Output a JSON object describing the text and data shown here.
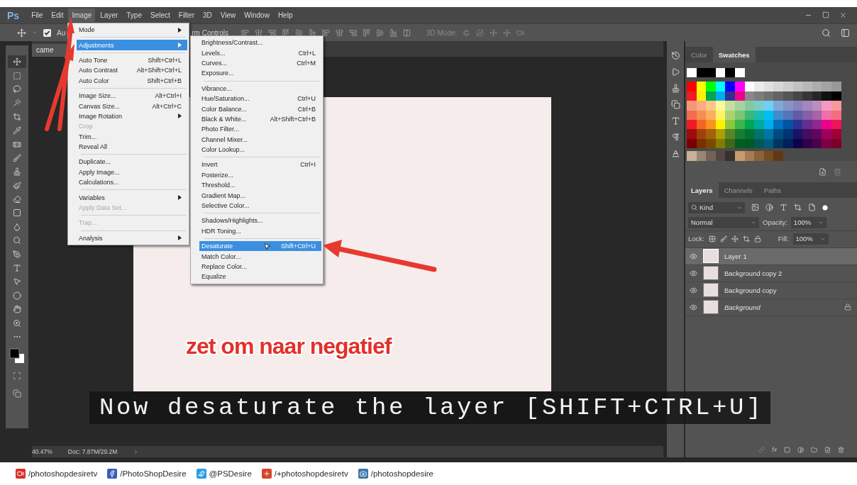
{
  "menu_bar": {
    "logo": "Ps",
    "items": [
      {
        "label": "File",
        "selected": false
      },
      {
        "label": "Edit",
        "selected": false
      },
      {
        "label": "Image",
        "selected": true
      },
      {
        "label": "Layer",
        "selected": false
      },
      {
        "label": "Type",
        "selected": false
      },
      {
        "label": "Select",
        "selected": false
      },
      {
        "label": "Filter",
        "selected": false
      },
      {
        "label": "3D",
        "selected": false
      },
      {
        "label": "View",
        "selected": false
      },
      {
        "label": "Window",
        "selected": false
      },
      {
        "label": "Help",
        "selected": false
      }
    ]
  },
  "options_bar": {
    "auto_select": {
      "label": "Au",
      "checked": true
    },
    "transform_label": "rm Controls",
    "mode_label": "3D Mode:"
  },
  "document_tab": {
    "label": "came"
  },
  "toolbar": {
    "tools": [
      {
        "kind": "move",
        "selected": true
      },
      {
        "kind": "marquee",
        "selected": false
      },
      {
        "kind": "lasso",
        "selected": false
      },
      {
        "kind": "wand",
        "selected": false
      },
      {
        "kind": "crop",
        "selected": false
      },
      {
        "kind": "eyedropper",
        "selected": false
      },
      {
        "kind": "bandage",
        "selected": false
      },
      {
        "kind": "brush",
        "selected": false
      },
      {
        "kind": "stamp",
        "selected": false
      },
      {
        "kind": "history",
        "selected": false
      },
      {
        "kind": "eraser",
        "selected": false
      },
      {
        "kind": "gradient",
        "selected": false
      },
      {
        "kind": "blur",
        "selected": false
      },
      {
        "kind": "dodge",
        "selected": false
      },
      {
        "kind": "pen",
        "selected": false
      },
      {
        "kind": "type",
        "selected": false
      },
      {
        "kind": "pointer",
        "selected": false
      },
      {
        "kind": "ellipse",
        "selected": false
      },
      {
        "kind": "hand",
        "selected": false
      },
      {
        "kind": "zoom",
        "selected": false
      },
      {
        "kind": "more",
        "selected": false
      }
    ]
  },
  "image_menu": {
    "groups": [
      {
        "items": [
          {
            "label": "Mode",
            "has_submenu": true,
            "disabled": false,
            "selected": false
          }
        ]
      },
      {
        "items": [
          {
            "label": "Adjustments",
            "has_submenu": true,
            "disabled": false,
            "selected": true
          }
        ]
      },
      {
        "items": [
          {
            "label": "Auto Tone",
            "shortcut": "Shift+Ctrl+L",
            "has_submenu": false,
            "disabled": false,
            "selected": false
          },
          {
            "label": "Auto Contrast",
            "shortcut": "Alt+Shift+Ctrl+L",
            "has_submenu": false,
            "disabled": false,
            "selected": false
          },
          {
            "label": "Auto Color",
            "shortcut": "Shift+Ctrl+B",
            "has_submenu": false,
            "disabled": false,
            "selected": false
          }
        ]
      },
      {
        "items": [
          {
            "label": "Image Size...",
            "shortcut": "Alt+Ctrl+I",
            "has_submenu": false,
            "disabled": false,
            "selected": false
          },
          {
            "label": "Canvas Size...",
            "shortcut": "Alt+Ctrl+C",
            "has_submenu": false,
            "disabled": false,
            "selected": false
          },
          {
            "label": "Image Rotation",
            "has_submenu": true,
            "disabled": false,
            "selected": false
          },
          {
            "label": "Crop",
            "has_submenu": false,
            "disabled": true,
            "selected": false
          },
          {
            "label": "Trim...",
            "has_submenu": false,
            "disabled": false,
            "selected": false
          },
          {
            "label": "Reveal All",
            "has_submenu": false,
            "disabled": false,
            "selected": false
          }
        ]
      },
      {
        "items": [
          {
            "label": "Duplicate...",
            "has_submenu": false,
            "disabled": false,
            "selected": false
          },
          {
            "label": "Apply Image...",
            "has_submenu": false,
            "disabled": false,
            "selected": false
          },
          {
            "label": "Calculations...",
            "has_submenu": false,
            "disabled": false,
            "selected": false
          }
        ]
      },
      {
        "items": [
          {
            "label": "Variables",
            "has_submenu": true,
            "disabled": false,
            "selected": false
          },
          {
            "label": "Apply Data Set...",
            "has_submenu": false,
            "disabled": true,
            "selected": false
          }
        ]
      },
      {
        "items": [
          {
            "label": "Trap...",
            "has_submenu": false,
            "disabled": true,
            "selected": false
          }
        ]
      },
      {
        "items": [
          {
            "label": "Analysis",
            "has_submenu": true,
            "disabled": false,
            "selected": false
          }
        ]
      }
    ]
  },
  "adjustments_menu": {
    "groups": [
      {
        "items": [
          {
            "label": "Brightness/Contrast...",
            "selected": false
          },
          {
            "label": "Levels...",
            "shortcut": "Ctrl+L",
            "selected": false
          },
          {
            "label": "Curves...",
            "shortcut": "Ctrl+M",
            "selected": false
          },
          {
            "label": "Exposure...",
            "selected": false
          }
        ]
      },
      {
        "items": [
          {
            "label": "Vibrance...",
            "selected": false
          },
          {
            "label": "Hue/Saturation...",
            "shortcut": "Ctrl+U",
            "selected": false
          },
          {
            "label": "Color Balance...",
            "shortcut": "Ctrl+B",
            "selected": false
          },
          {
            "label": "Black & White...",
            "shortcut": "Alt+Shift+Ctrl+B",
            "selected": false
          },
          {
            "label": "Photo Filter...",
            "selected": false
          },
          {
            "label": "Channel Mixer...",
            "selected": false
          },
          {
            "label": "Color Lookup...",
            "selected": false
          }
        ]
      },
      {
        "items": [
          {
            "label": "Invert",
            "shortcut": "Ctrl+I",
            "selected": false
          },
          {
            "label": "Posterize...",
            "selected": false
          },
          {
            "label": "Threshold...",
            "selected": false
          },
          {
            "label": "Gradient Map...",
            "selected": false
          },
          {
            "label": "Selective Color...",
            "selected": false
          }
        ]
      },
      {
        "items": [
          {
            "label": "Shadows/Highlights...",
            "selected": false
          },
          {
            "label": "HDR Toning...",
            "selected": false
          }
        ]
      },
      {
        "items": [
          {
            "label": "Desaturate",
            "shortcut": "Shift+Ctrl+U",
            "selected": true
          },
          {
            "label": "Match Color...",
            "selected": false
          },
          {
            "label": "Replace Color...",
            "selected": false
          },
          {
            "label": "Equalize",
            "selected": false
          }
        ]
      }
    ]
  },
  "caption": {
    "overlay_text": "zet om naar negatief",
    "subtitle": "Now desaturate the layer [SHIFT+CTRL+U]"
  },
  "status_bar": {
    "zoom": "40.47%",
    "doc_size": "Doc: 7.87M/29.2M"
  },
  "swatches_panel": {
    "tabs": [
      {
        "label": "Color",
        "selected": false
      },
      {
        "label": "Swatches",
        "selected": true
      }
    ],
    "rows": [
      {
        "swatches": [
          {
            "color": "#ffffff"
          },
          {
            "color": "#000000"
          },
          {
            "color": "#000000"
          },
          {
            "color": "#ffffff"
          },
          {
            "color": "#000000"
          },
          {
            "color": "#ffffff"
          }
        ]
      },
      {
        "swatches": [
          {
            "color": "#ff0000"
          },
          {
            "color": "#ffff00"
          },
          {
            "color": "#00ff00"
          },
          {
            "color": "#00ffff"
          },
          {
            "color": "#0000ff"
          },
          {
            "color": "#ff00ff"
          },
          {
            "color": "#ffffff"
          },
          {
            "color": "#ebebeb"
          },
          {
            "color": "#e0e0e0"
          },
          {
            "color": "#d6d6d6"
          },
          {
            "color": "#cccccc"
          },
          {
            "color": "#c2c2c2"
          },
          {
            "color": "#b8b8b8"
          },
          {
            "color": "#adadad"
          },
          {
            "color": "#a3a3a3"
          },
          {
            "color": "#999999"
          }
        ]
      },
      {
        "swatches": [
          {
            "color": "#ed1c24"
          },
          {
            "color": "#fff200"
          },
          {
            "color": "#00a651"
          },
          {
            "color": "#00aeef"
          },
          {
            "color": "#2e3192"
          },
          {
            "color": "#ec008c"
          },
          {
            "color": "#898989"
          },
          {
            "color": "#7d7d7d"
          },
          {
            "color": "#707070"
          },
          {
            "color": "#636363"
          },
          {
            "color": "#555555"
          },
          {
            "color": "#464646"
          },
          {
            "color": "#363636"
          },
          {
            "color": "#262626"
          },
          {
            "color": "#111111"
          },
          {
            "color": "#000000"
          }
        ]
      },
      {
        "swatches": [
          {
            "color": "#f7977a"
          },
          {
            "color": "#f9ad81"
          },
          {
            "color": "#fdc68a"
          },
          {
            "color": "#fff79a"
          },
          {
            "color": "#c4df9b"
          },
          {
            "color": "#a3d39c"
          },
          {
            "color": "#82ca9d"
          },
          {
            "color": "#7bcdc8"
          },
          {
            "color": "#6ecff6"
          },
          {
            "color": "#7ea7d8"
          },
          {
            "color": "#8493ca"
          },
          {
            "color": "#8882be"
          },
          {
            "color": "#a187be"
          },
          {
            "color": "#bc8dbf"
          },
          {
            "color": "#f49ac2"
          },
          {
            "color": "#f6989d"
          }
        ]
      },
      {
        "swatches": [
          {
            "color": "#f26c4f"
          },
          {
            "color": "#f68e55"
          },
          {
            "color": "#fbaf5c"
          },
          {
            "color": "#fff467"
          },
          {
            "color": "#acd372"
          },
          {
            "color": "#7cc576"
          },
          {
            "color": "#3bb878"
          },
          {
            "color": "#1abbb4"
          },
          {
            "color": "#00bff3"
          },
          {
            "color": "#438ccb"
          },
          {
            "color": "#5574b9"
          },
          {
            "color": "#605ca8"
          },
          {
            "color": "#855fa8"
          },
          {
            "color": "#a763a8"
          },
          {
            "color": "#f06ea9"
          },
          {
            "color": "#f26d7d"
          }
        ]
      },
      {
        "swatches": [
          {
            "color": "#ed1c24"
          },
          {
            "color": "#f26522"
          },
          {
            "color": "#f7941d"
          },
          {
            "color": "#fff200"
          },
          {
            "color": "#8dc73f"
          },
          {
            "color": "#39b54a"
          },
          {
            "color": "#00a651"
          },
          {
            "color": "#00a99d"
          },
          {
            "color": "#00aeef"
          },
          {
            "color": "#0072bc"
          },
          {
            "color": "#0054a6"
          },
          {
            "color": "#2e3192"
          },
          {
            "color": "#662d91"
          },
          {
            "color": "#92278f"
          },
          {
            "color": "#ec008c"
          },
          {
            "color": "#ed145b"
          }
        ]
      },
      {
        "swatches": [
          {
            "color": "#9e0b0f"
          },
          {
            "color": "#a0410d"
          },
          {
            "color": "#a36209"
          },
          {
            "color": "#aba000"
          },
          {
            "color": "#598527"
          },
          {
            "color": "#1a7b30"
          },
          {
            "color": "#007236"
          },
          {
            "color": "#00746b"
          },
          {
            "color": "#0076a3"
          },
          {
            "color": "#004b80"
          },
          {
            "color": "#003471"
          },
          {
            "color": "#1b1464"
          },
          {
            "color": "#440e62"
          },
          {
            "color": "#630460"
          },
          {
            "color": "#9e005d"
          },
          {
            "color": "#9e0039"
          }
        ]
      },
      {
        "swatches": [
          {
            "color": "#790000"
          },
          {
            "color": "#7b2e00"
          },
          {
            "color": "#7d4900"
          },
          {
            "color": "#827b00"
          },
          {
            "color": "#406618"
          },
          {
            "color": "#005e20"
          },
          {
            "color": "#005826"
          },
          {
            "color": "#005952"
          },
          {
            "color": "#005b7f"
          },
          {
            "color": "#003663"
          },
          {
            "color": "#002157"
          },
          {
            "color": "#0d004c"
          },
          {
            "color": "#32004b"
          },
          {
            "color": "#4b0049"
          },
          {
            "color": "#7b0046"
          },
          {
            "color": "#7a0026"
          }
        ]
      },
      {
        "swatches": [
          {
            "color": "#c7b299"
          },
          {
            "color": "#998675"
          },
          {
            "color": "#736357"
          },
          {
            "color": "#534741"
          },
          {
            "color": "#37302d"
          },
          {
            "color": "#c69c6d"
          },
          {
            "color": "#a67c52"
          },
          {
            "color": "#8c6239"
          },
          {
            "color": "#754c24"
          },
          {
            "color": "#603913"
          }
        ]
      }
    ]
  },
  "layers_panel": {
    "tabs": [
      {
        "label": "Layers",
        "selected": true
      },
      {
        "label": "Channels",
        "selected": false
      },
      {
        "label": "Paths",
        "selected": false
      }
    ],
    "filter": "Kind",
    "blend_mode": "Normal",
    "opacity_label": "Opacity:",
    "opacity": "100%",
    "lock_label": "Lock:",
    "fill_label": "Fill:",
    "fill": "100%",
    "layers": [
      {
        "name": "Layer 1",
        "kind": "layer",
        "selected": true
      },
      {
        "name": "Background copy 2",
        "kind": "layer",
        "selected": false
      },
      {
        "name": "Background copy",
        "kind": "layer",
        "selected": false
      },
      {
        "name": "Background",
        "kind": "background",
        "selected": false
      }
    ],
    "fx_label": "fx"
  },
  "social_bar": {
    "links": [
      {
        "kind": "video",
        "label": "/photoshopdesiretv"
      },
      {
        "kind": "f",
        "label": "/PhotoShopDesire"
      },
      {
        "kind": "bird",
        "label": "@PSDesire"
      },
      {
        "kind": "plus",
        "label": "/+photoshopdesiretv"
      },
      {
        "kind": "camera",
        "label": "/photoshopdesire"
      }
    ]
  }
}
